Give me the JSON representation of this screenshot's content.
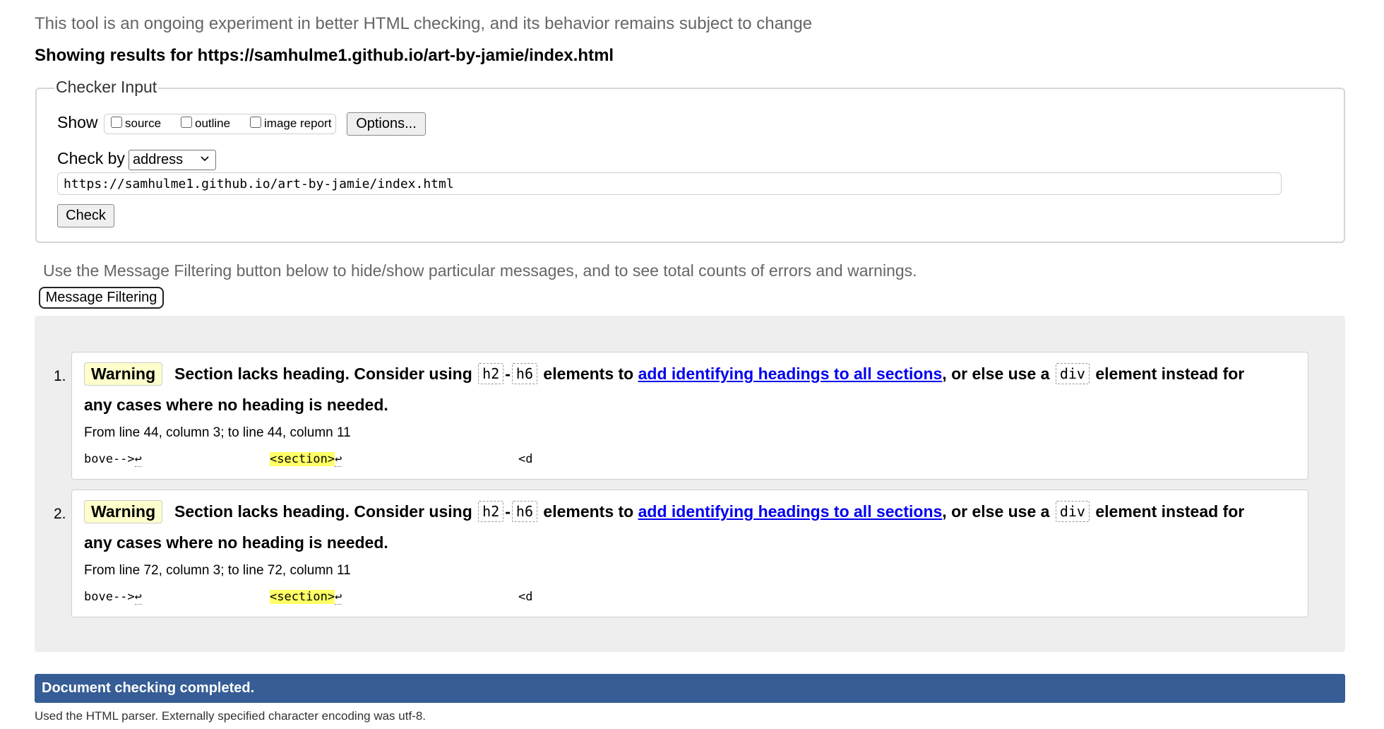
{
  "notice": "This tool is an ongoing experiment in better HTML checking, and its behavior remains subject to change",
  "results_heading": "Showing results for https://samhulme1.github.io/art-by-jamie/index.html",
  "checker": {
    "legend": "Checker Input",
    "show_label": "Show",
    "checkboxes": [
      "source",
      "outline",
      "image report"
    ],
    "options_label": "Options...",
    "check_by_label": "Check by",
    "check_by_value": "address",
    "url_value": "https://samhulme1.github.io/art-by-jamie/index.html",
    "check_label": "Check"
  },
  "filter": {
    "hint": "Use the Message Filtering button below to hide/show particular messages, and to see total counts of errors and warnings.",
    "button_label": "Message Filtering"
  },
  "messages": [
    {
      "number": "1.",
      "type": "Warning",
      "text_a": "Section lacks heading. Consider using",
      "code_a": "h2",
      "dash": "-",
      "code_b": "h6",
      "text_b": "elements to",
      "link": "add identifying headings to all sections",
      "text_c": ", or else use a",
      "code_c": "div",
      "text_d": "element instead for",
      "text_e": "any cases where no heading is needed.",
      "location": "From line 44, column 3; to line 44, column 11",
      "extract_before": "bove-->",
      "extract_hl": "<section>",
      "extract_after": "<d",
      "return_glyph": "↩"
    },
    {
      "number": "2.",
      "type": "Warning",
      "text_a": "Section lacks heading. Consider using",
      "code_a": "h2",
      "dash": "-",
      "code_b": "h6",
      "text_b": "elements to",
      "link": "add identifying headings to all sections",
      "text_c": ", or else use a",
      "code_c": "div",
      "text_d": "element instead for",
      "text_e": "any cases where no heading is needed.",
      "location": "From line 72, column 3; to line 72, column 11",
      "extract_before": "bove-->",
      "extract_hl": "<section>",
      "extract_after": "<d",
      "return_glyph": "↩"
    }
  ],
  "done": "Document checking completed.",
  "parser_info": "Used the HTML parser. Externally specified character encoding was utf-8."
}
